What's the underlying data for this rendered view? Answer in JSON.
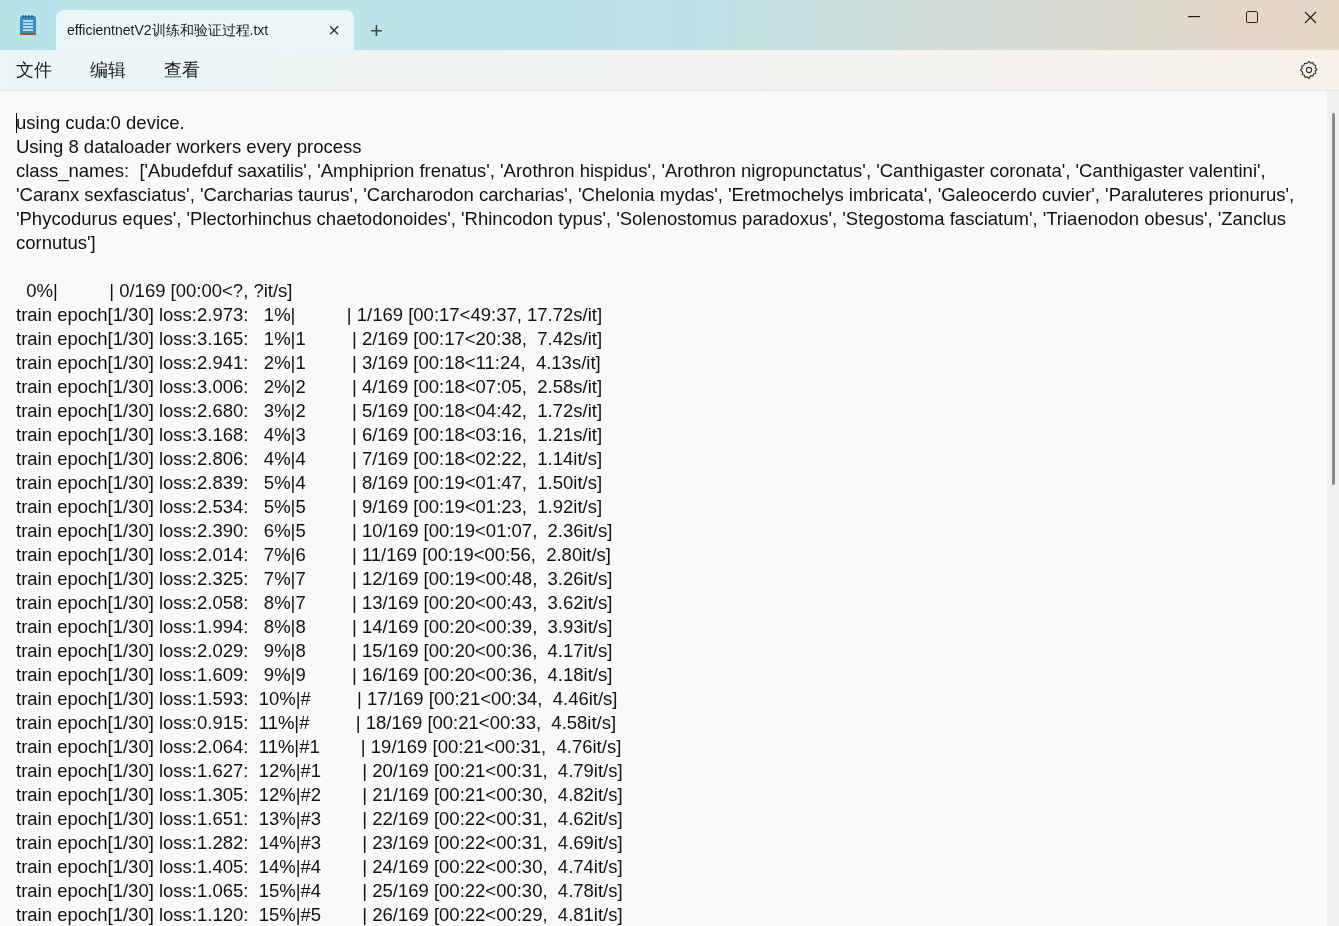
{
  "tab": {
    "title": "efficientnetV2训练和验证过程.txt",
    "close": "×",
    "new_tab": "+"
  },
  "menu": [
    {
      "label": "文件"
    },
    {
      "label": "编辑"
    },
    {
      "label": "查看"
    }
  ],
  "document": {
    "header_lines": [
      "using cuda:0 device.",
      "Using 8 dataloader workers every process",
      "class_names:  ['Abudefduf saxatilis', 'Amphiprion frenatus', 'Arothron hispidus', 'Arothron nigropunctatus', 'Canthigaster coronata', 'Canthigaster valentini', 'Caranx sexfasciatus', 'Carcharias taurus', 'Carcharodon carcharias', 'Chelonia mydas', 'Eretmochelys imbricata', 'Galeocerdo cuvier', 'Paraluteres prionurus', 'Phycodurus eques', 'Plectorhinchus chaetodonoides', 'Rhincodon typus', 'Solenostomus paradoxus', 'Stegostoma fasciatum', 'Triaenodon obesus', 'Zanclus cornutus']"
    ],
    "progress_lines": [
      "  0%|          | 0/169 [00:00<?, ?it/s]",
      "train epoch[1/30] loss:2.973:   1%|          | 1/169 [00:17<49:37, 17.72s/it]",
      "train epoch[1/30] loss:3.165:   1%|1         | 2/169 [00:17<20:38,  7.42s/it]",
      "train epoch[1/30] loss:2.941:   2%|1         | 3/169 [00:18<11:24,  4.13s/it]",
      "train epoch[1/30] loss:3.006:   2%|2         | 4/169 [00:18<07:05,  2.58s/it]",
      "train epoch[1/30] loss:2.680:   3%|2         | 5/169 [00:18<04:42,  1.72s/it]",
      "train epoch[1/30] loss:3.168:   4%|3         | 6/169 [00:18<03:16,  1.21s/it]",
      "train epoch[1/30] loss:2.806:   4%|4         | 7/169 [00:18<02:22,  1.14it/s]",
      "train epoch[1/30] loss:2.839:   5%|4         | 8/169 [00:19<01:47,  1.50it/s]",
      "train epoch[1/30] loss:2.534:   5%|5         | 9/169 [00:19<01:23,  1.92it/s]",
      "train epoch[1/30] loss:2.390:   6%|5         | 10/169 [00:19<01:07,  2.36it/s]",
      "train epoch[1/30] loss:2.014:   7%|6         | 11/169 [00:19<00:56,  2.80it/s]",
      "train epoch[1/30] loss:2.325:   7%|7         | 12/169 [00:19<00:48,  3.26it/s]",
      "train epoch[1/30] loss:2.058:   8%|7         | 13/169 [00:20<00:43,  3.62it/s]",
      "train epoch[1/30] loss:1.994:   8%|8         | 14/169 [00:20<00:39,  3.93it/s]",
      "train epoch[1/30] loss:2.029:   9%|8         | 15/169 [00:20<00:36,  4.17it/s]",
      "train epoch[1/30] loss:1.609:   9%|9         | 16/169 [00:20<00:36,  4.18it/s]",
      "train epoch[1/30] loss:1.593:  10%|#         | 17/169 [00:21<00:34,  4.46it/s]",
      "train epoch[1/30] loss:0.915:  11%|#         | 18/169 [00:21<00:33,  4.58it/s]",
      "train epoch[1/30] loss:2.064:  11%|#1        | 19/169 [00:21<00:31,  4.76it/s]",
      "train epoch[1/30] loss:1.627:  12%|#1        | 20/169 [00:21<00:31,  4.79it/s]",
      "train epoch[1/30] loss:1.305:  12%|#2        | 21/169 [00:21<00:30,  4.82it/s]",
      "train epoch[1/30] loss:1.651:  13%|#3        | 22/169 [00:22<00:31,  4.62it/s]",
      "train epoch[1/30] loss:1.282:  14%|#3        | 23/169 [00:22<00:31,  4.69it/s]",
      "train epoch[1/30] loss:1.405:  14%|#4        | 24/169 [00:22<00:30,  4.74it/s]",
      "train epoch[1/30] loss:1.065:  15%|#4        | 25/169 [00:22<00:30,  4.78it/s]",
      "train epoch[1/30] loss:1.120:  15%|#5        | 26/169 [00:22<00:29,  4.81it/s]"
    ]
  }
}
